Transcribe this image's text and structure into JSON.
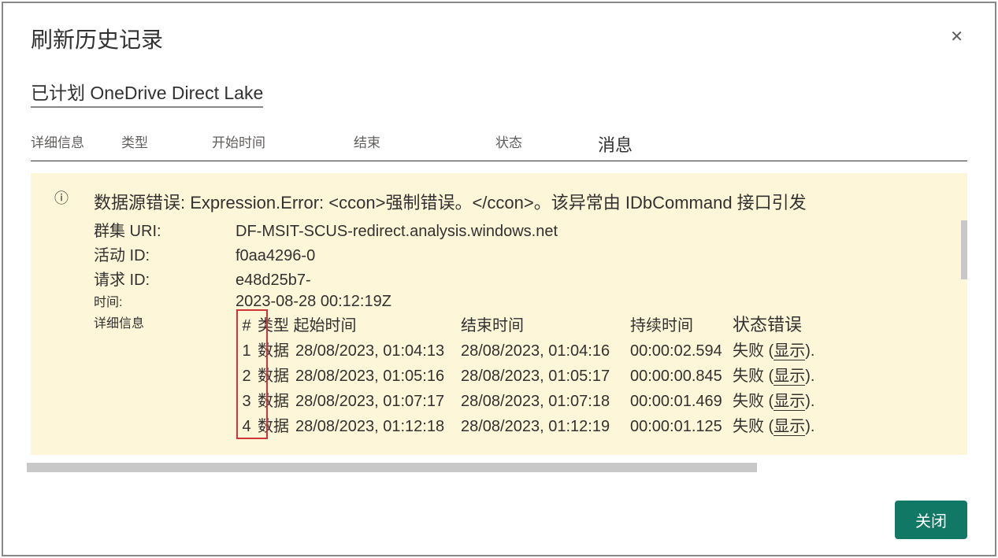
{
  "dialog": {
    "title": "刷新历史记录",
    "subtitle": "已计划 OneDrive Direct Lake",
    "close_button": "关闭"
  },
  "columns": {
    "details": "详细信息",
    "type": "类型",
    "start": "开始时间",
    "end": "结束",
    "status": "状态",
    "message": "消息"
  },
  "error": {
    "message": "数据源错误: Expression.Error:  <ccon>强制错误。</ccon>。该异常由 IDbCommand 接口引发",
    "labels": {
      "cluster_uri": "群集 URI:",
      "activity_id": "活动 ID:",
      "request_id": "请求 ID:",
      "time": "时间:",
      "details": "详细信息"
    },
    "cluster_uri": "DF-MSIT-SCUS-redirect.analysis.windows.net",
    "activity_id": "f0aa4296-0",
    "request_id": "e48d25b7-",
    "time": "2023-08-28 00:12:19Z"
  },
  "detail_header": {
    "num": "#",
    "type_start": "类型 起始时间",
    "end": "结束时间",
    "duration": "持续时间",
    "status_error": "状态错误"
  },
  "detail_rows": [
    {
      "num": "1",
      "type": "数据",
      "start": "28/08/2023, 01:04:13",
      "end": "28/08/2023, 01:04:16",
      "duration": "00:00:02.594",
      "status": "失败",
      "show": "显示"
    },
    {
      "num": "2",
      "type": "数据",
      "start": "28/08/2023, 01:05:16",
      "end": "28/08/2023, 01:05:17",
      "duration": "00:00:00.845",
      "status": "失败",
      "show": "显示"
    },
    {
      "num": "3",
      "type": "数据",
      "start": "28/08/2023, 01:07:17",
      "end": "28/08/2023, 01:07:18",
      "duration": "00:00:01.469",
      "status": "失败",
      "show": "显示"
    },
    {
      "num": "4",
      "type": "数据",
      "start": "28/08/2023, 01:12:18",
      "end": "28/08/2023, 01:12:19",
      "duration": "00:00:01.125",
      "status": "失败",
      "show": "显示"
    }
  ]
}
